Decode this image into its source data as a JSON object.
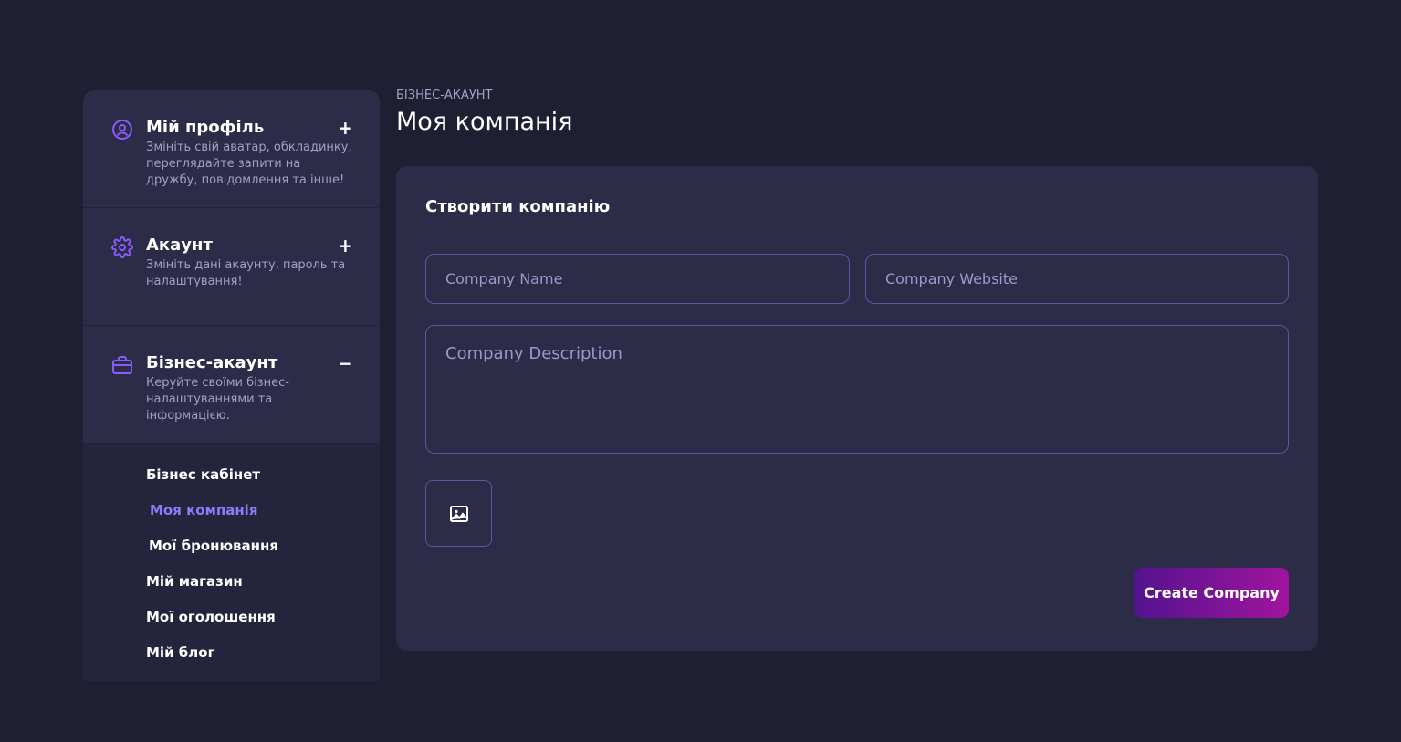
{
  "sidebar": {
    "sections": [
      {
        "title": "Мій профіль",
        "description": "Змініть свій аватар, обкладинку, переглядайте запити на дружбу, повідомлення та інше!",
        "toggle": "+",
        "icon": "user-circle-icon"
      },
      {
        "title": "Акаунт",
        "description": "Змініть дані акаунту, пароль та налаштування!",
        "toggle": "+",
        "icon": "gear-icon"
      },
      {
        "title": "Бізнес-акаунт",
        "description": "Керуйте своїми бізнес-налаштуваннями та інформацією.",
        "toggle": "−",
        "icon": "briefcase-icon"
      }
    ],
    "submenu": [
      "Бізнес кабінет",
      "Моя компанія",
      "Мої бронювання",
      "Мій магазин",
      "Мої оголошення",
      "Мій блог"
    ],
    "active_item": "Моя компанія"
  },
  "header": {
    "breadcrumb": "БІЗНЕС-АКАУНТ",
    "title": "Моя компанія"
  },
  "form": {
    "title": "Створити компанію",
    "name_placeholder": "Company Name",
    "website_placeholder": "Company Website",
    "description_placeholder": "Company Description",
    "image_icon": "image-icon",
    "submit_label": "Create Company"
  },
  "colors": {
    "background": "#1f1f33",
    "panel": "#2c2b48",
    "accent": "#8a5cf6",
    "active_link": "#8b7cf8",
    "button_gradient_start": "#53138f",
    "button_gradient_end": "#a0149d"
  }
}
